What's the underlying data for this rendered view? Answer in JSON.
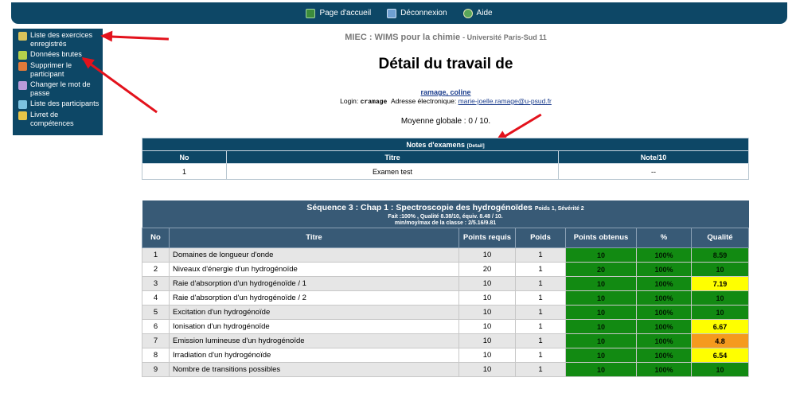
{
  "topbar": {
    "home": "Page d'accueil",
    "logout": "Déconnexion",
    "help": "Aide"
  },
  "sidebar": [
    {
      "label": "Liste des exercices enregistrés",
      "icon": "list-icon"
    },
    {
      "label": "Données brutes",
      "icon": "data-icon"
    },
    {
      "label": "Supprimer le participant",
      "icon": "delete-icon"
    },
    {
      "label": "Changer le mot de passe",
      "icon": "password-icon"
    },
    {
      "label": "Liste des participants",
      "icon": "participants-icon"
    },
    {
      "label": "Livret de compétences",
      "icon": "booklet-icon"
    }
  ],
  "site": {
    "name": "MIEC : WIMS pour la chimie",
    "university": "- Université Paris-Sud 11"
  },
  "page_title": "Détail du travail de",
  "student": {
    "name": "ramage, coline",
    "login_label": "Login:",
    "login": "cramage",
    "email_label": "Adresse électronique:",
    "email": "marie-joelle.ramage@u-psud.fr"
  },
  "average": "Moyenne globale : 0 / 10.",
  "exams": {
    "title": "Notes d'examens",
    "detail": "[Detail]",
    "headers": [
      "No",
      "Titre",
      "Note/10"
    ],
    "rows": [
      [
        "1",
        "Examen test",
        "--"
      ]
    ]
  },
  "sequence": {
    "title": "Séquence 3 : Chap 1 : Spectroscopie des hydrogénoïdes",
    "weights": "Poids 1, Sévérité 2",
    "line1": "Fait :100% , Qualité  8.38/10, équiv. 8.48 / 10.",
    "line2": "min/moy/max de la classe : 2/5.16/9.81",
    "headers": [
      "No",
      "Titre",
      "Points requis",
      "Poids",
      "Points obtenus",
      "%",
      "Qualité"
    ],
    "rows": [
      [
        "1",
        "Domaines de longueur d'onde",
        "10",
        "1",
        "10",
        "100%",
        "8.59",
        "g"
      ],
      [
        "2",
        "Niveaux d'énergie d'un hydrogénoïde",
        "20",
        "1",
        "20",
        "100%",
        "10",
        "g"
      ],
      [
        "3",
        "Raie d'absorption d'un hydrogénoïde / 1",
        "10",
        "1",
        "10",
        "100%",
        "7.19",
        "y"
      ],
      [
        "4",
        "Raie d'absorption d'un hydrogénoïde / 2",
        "10",
        "1",
        "10",
        "100%",
        "10",
        "g"
      ],
      [
        "5",
        "Excitation d'un hydrogénoïde",
        "10",
        "1",
        "10",
        "100%",
        "10",
        "g"
      ],
      [
        "6",
        "Ionisation d'un hydrogénoïde",
        "10",
        "1",
        "10",
        "100%",
        "6.67",
        "y"
      ],
      [
        "7",
        "Emission lumineuse d'un hydrogénoïde",
        "10",
        "1",
        "10",
        "100%",
        "4.8",
        "o"
      ],
      [
        "8",
        "Irradiation d'un hydrogénoïde",
        "10",
        "1",
        "10",
        "100%",
        "6.54",
        "y"
      ],
      [
        "9",
        "Nombre de transitions possibles",
        "10",
        "1",
        "10",
        "100%",
        "10",
        "g"
      ]
    ]
  },
  "colors": {
    "nav": "#0d4766",
    "ok": "#128a12",
    "warn": "#ffff00",
    "low": "#f59a1e",
    "arrow": "#e3121c"
  }
}
